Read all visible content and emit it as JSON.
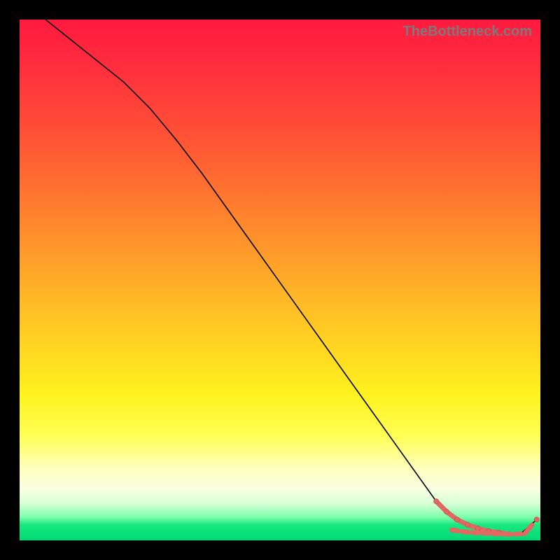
{
  "watermark": "TheBottleneck.com",
  "chart_data": {
    "type": "line",
    "title": "",
    "xlabel": "",
    "ylabel": "",
    "xlim": [
      0,
      100
    ],
    "ylim": [
      0,
      100
    ],
    "series": [
      {
        "name": "curve",
        "style": "thin-black",
        "x": [
          5,
          10,
          15,
          20,
          25,
          30,
          35,
          40,
          45,
          50,
          55,
          60,
          65,
          70,
          75,
          80,
          82,
          84,
          86,
          88,
          90,
          92,
          94,
          96,
          99.3
        ],
        "values": [
          100,
          96,
          92,
          88,
          83,
          77,
          70.5,
          63.5,
          56.5,
          49.5,
          42.5,
          35.5,
          28.5,
          21.5,
          14.5,
          7.5,
          5.5,
          4,
          3,
          2.3,
          1.8,
          1.5,
          1.2,
          1.1,
          4
        ]
      },
      {
        "name": "highlight",
        "style": "thick-salmon",
        "x": [
          80,
          82,
          84,
          86,
          88,
          90,
          92,
          94
        ],
        "values": [
          7.5,
          5.5,
          4,
          3,
          2.3,
          1.8,
          1.5,
          1.2
        ]
      },
      {
        "name": "flat-dash",
        "style": "dash-dots",
        "x": [
          83,
          85,
          87,
          89,
          91,
          93,
          95,
          97,
          99.3
        ],
        "values": [
          2.0,
          1.7,
          1.5,
          1.4,
          1.3,
          1.2,
          1.2,
          1.3,
          4
        ]
      }
    ]
  },
  "colors": {
    "salmon": "#e06a62",
    "black": "#000000"
  }
}
